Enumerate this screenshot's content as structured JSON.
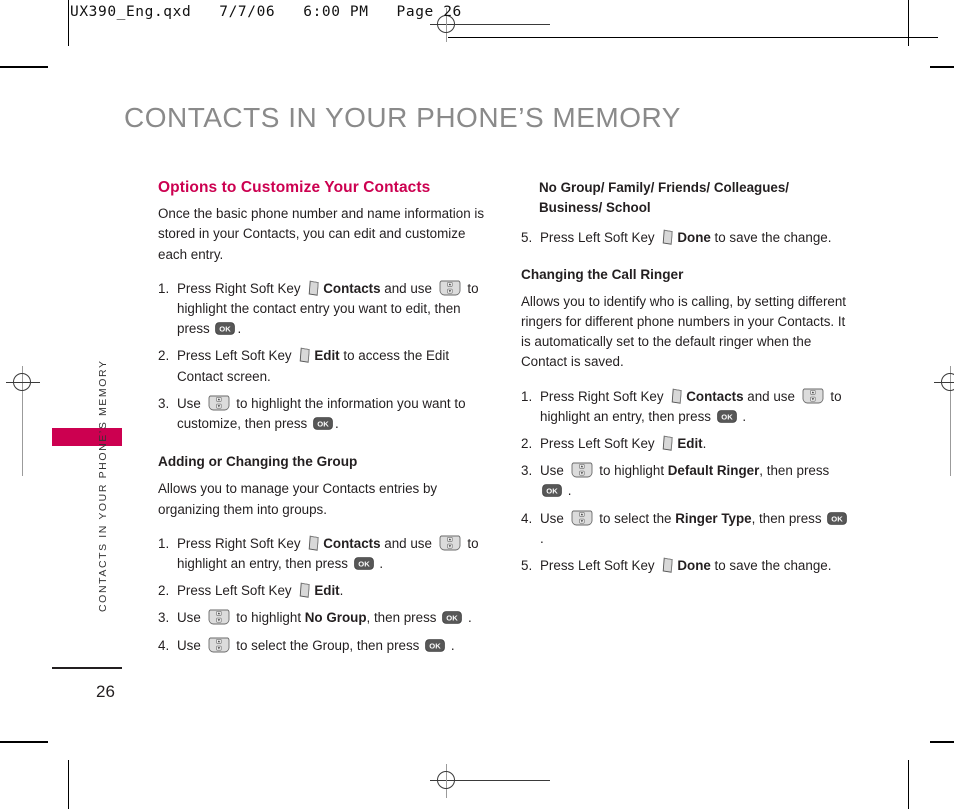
{
  "print_slug": {
    "text": "UX390_Eng.qxd   7/7/06   6:00 PM   Page 26"
  },
  "page_title": "CONTACTS IN YOUR PHONE’S MEMORY",
  "side_tab": {
    "label": "CONTACTS IN YOUR PHONE’S MEMORY",
    "color": "#cc0050"
  },
  "folio": "26",
  "icons": {
    "soft_key": "soft-key-icon",
    "nav_key": "navigation-key-icon",
    "ok_key": "ok-key-icon",
    "ok_label": "OK"
  },
  "left_column": {
    "section_heading": "Options to Customize Your Contacts",
    "intro": "Once the basic phone number and name information is stored in your Contacts, you can edit and customize each entry.",
    "steps": [
      {
        "num": "1.",
        "parts": [
          {
            "t": "text",
            "v": "Press Right Soft Key "
          },
          {
            "t": "icon",
            "v": "soft"
          },
          {
            "t": "bold",
            "v": "Contacts"
          },
          {
            "t": "text",
            "v": " and use "
          },
          {
            "t": "icon",
            "v": "nav"
          },
          {
            "t": "text",
            "v": " to highlight the contact entry you want to edit, then press "
          },
          {
            "t": "icon",
            "v": "ok"
          },
          {
            "t": "text",
            "v": "."
          }
        ]
      },
      {
        "num": "2.",
        "parts": [
          {
            "t": "text",
            "v": "Press Left Soft Key "
          },
          {
            "t": "icon",
            "v": "soft"
          },
          {
            "t": "bold",
            "v": "Edit"
          },
          {
            "t": "text",
            "v": " to access the Edit Contact screen."
          }
        ]
      },
      {
        "num": "3.",
        "parts": [
          {
            "t": "text",
            "v": "Use "
          },
          {
            "t": "icon",
            "v": "nav"
          },
          {
            "t": "text",
            "v": " to highlight the information you want to customize, then press "
          },
          {
            "t": "icon",
            "v": "ok"
          },
          {
            "t": "text",
            "v": "."
          }
        ]
      }
    ],
    "subsection_heading": "Adding or Changing the Group",
    "subsection_intro": "Allows you to manage your Contacts entries by organizing them into groups.",
    "subsection_steps": [
      {
        "num": "1.",
        "parts": [
          {
            "t": "text",
            "v": "Press Right Soft Key "
          },
          {
            "t": "icon",
            "v": "soft"
          },
          {
            "t": "bold",
            "v": "Contacts"
          },
          {
            "t": "text",
            "v": " and use "
          },
          {
            "t": "icon",
            "v": "nav"
          },
          {
            "t": "text",
            "v": " to highlight an entry, then press "
          },
          {
            "t": "icon",
            "v": "ok"
          },
          {
            "t": "text",
            "v": " ."
          }
        ]
      },
      {
        "num": "2.",
        "parts": [
          {
            "t": "text",
            "v": "Press Left Soft Key "
          },
          {
            "t": "icon",
            "v": "soft"
          },
          {
            "t": "bold",
            "v": "Edit"
          },
          {
            "t": "text",
            "v": "."
          }
        ]
      },
      {
        "num": "3.",
        "parts": [
          {
            "t": "text",
            "v": "Use "
          },
          {
            "t": "icon",
            "v": "nav"
          },
          {
            "t": "text",
            "v": " to highlight "
          },
          {
            "t": "bold",
            "v": "No Group"
          },
          {
            "t": "text",
            "v": ", then press "
          },
          {
            "t": "icon",
            "v": "ok"
          },
          {
            "t": "text",
            "v": " ."
          }
        ]
      },
      {
        "num": "4.",
        "parts": [
          {
            "t": "text",
            "v": "Use "
          },
          {
            "t": "icon",
            "v": "nav"
          },
          {
            "t": "text",
            "v": " to select the Group, then press "
          },
          {
            "t": "icon",
            "v": "ok"
          },
          {
            "t": "text",
            "v": " ."
          }
        ]
      }
    ]
  },
  "right_column": {
    "group_options": "No Group/ Family/ Friends/ Colleagues/ Business/ School",
    "group_final_step": {
      "num": "5.",
      "parts": [
        {
          "t": "text",
          "v": "Press Left Soft Key "
        },
        {
          "t": "icon",
          "v": "soft"
        },
        {
          "t": "bold",
          "v": "Done"
        },
        {
          "t": "text",
          "v": " to save the change."
        }
      ]
    },
    "subsection_heading": "Changing the Call Ringer",
    "subsection_intro": "Allows you to identify who is calling, by setting different ringers for different phone numbers in your Contacts. It is automatically set to the default ringer when the Contact is saved.",
    "steps": [
      {
        "num": "1.",
        "parts": [
          {
            "t": "text",
            "v": "Press Right Soft Key "
          },
          {
            "t": "icon",
            "v": "soft"
          },
          {
            "t": "bold",
            "v": "Contacts"
          },
          {
            "t": "text",
            "v": " and use "
          },
          {
            "t": "icon",
            "v": "nav"
          },
          {
            "t": "text",
            "v": " to highlight an entry, then press "
          },
          {
            "t": "icon",
            "v": "ok"
          },
          {
            "t": "text",
            "v": " ."
          }
        ]
      },
      {
        "num": "2.",
        "parts": [
          {
            "t": "text",
            "v": "Press Left Soft Key "
          },
          {
            "t": "icon",
            "v": "soft"
          },
          {
            "t": "bold",
            "v": "Edit"
          },
          {
            "t": "text",
            "v": "."
          }
        ]
      },
      {
        "num": "3.",
        "parts": [
          {
            "t": "text",
            "v": "Use "
          },
          {
            "t": "icon",
            "v": "nav"
          },
          {
            "t": "text",
            "v": " to highlight "
          },
          {
            "t": "bold",
            "v": "Default Ringer"
          },
          {
            "t": "text",
            "v": ", then press "
          },
          {
            "t": "icon",
            "v": "ok"
          },
          {
            "t": "text",
            "v": " ."
          }
        ]
      },
      {
        "num": "4.",
        "parts": [
          {
            "t": "text",
            "v": "Use "
          },
          {
            "t": "icon",
            "v": "nav"
          },
          {
            "t": "text",
            "v": " to select the "
          },
          {
            "t": "bold",
            "v": "Ringer Type"
          },
          {
            "t": "text",
            "v": ", then press "
          },
          {
            "t": "icon",
            "v": "ok"
          },
          {
            "t": "text",
            "v": " ."
          }
        ]
      },
      {
        "num": "5.",
        "parts": [
          {
            "t": "text",
            "v": "Press Left Soft Key "
          },
          {
            "t": "icon",
            "v": "soft"
          },
          {
            "t": "bold",
            "v": "Done"
          },
          {
            "t": "text",
            "v": " to save the change."
          }
        ]
      }
    ]
  }
}
